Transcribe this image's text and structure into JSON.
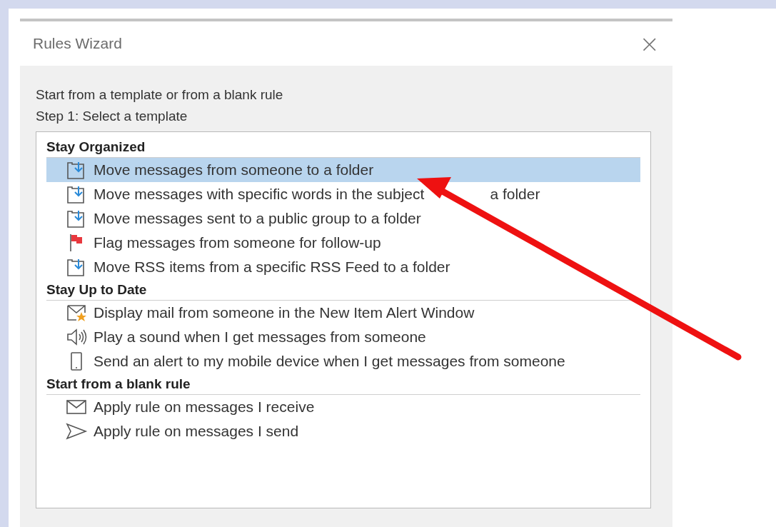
{
  "window": {
    "title": "Rules Wizard",
    "close": "×"
  },
  "intro": "Start from a template or from a blank rule",
  "step": "Step 1: Select a template",
  "groups": [
    {
      "title": "Stay Organized",
      "items": [
        {
          "label": "Move messages from someone to a folder",
          "kind": "move",
          "selected": true
        },
        {
          "label": "Move messages with specific words in the subject",
          "label_after": "a folder",
          "kind": "move",
          "selected": false
        },
        {
          "label": "Move messages sent to a public group to a folder",
          "kind": "move",
          "selected": false
        },
        {
          "label": "Flag messages from someone for follow-up",
          "kind": "flag",
          "selected": false
        },
        {
          "label": "Move RSS items from a specific RSS Feed to a folder",
          "kind": "move",
          "selected": false
        }
      ]
    },
    {
      "title": "Stay Up to Date",
      "items": [
        {
          "label": "Display mail from someone in the New Item Alert Window",
          "kind": "alert",
          "selected": false
        },
        {
          "label": "Play a sound when I get messages from someone",
          "kind": "sound",
          "selected": false
        },
        {
          "label": "Send an alert to my mobile device when I get messages from someone",
          "kind": "mobile",
          "selected": false
        }
      ]
    },
    {
      "title": "Start from a blank rule",
      "items": [
        {
          "label": "Apply rule on messages I receive",
          "kind": "mail",
          "selected": false
        },
        {
          "label": "Apply rule on messages I send",
          "kind": "send",
          "selected": false
        }
      ]
    }
  ]
}
